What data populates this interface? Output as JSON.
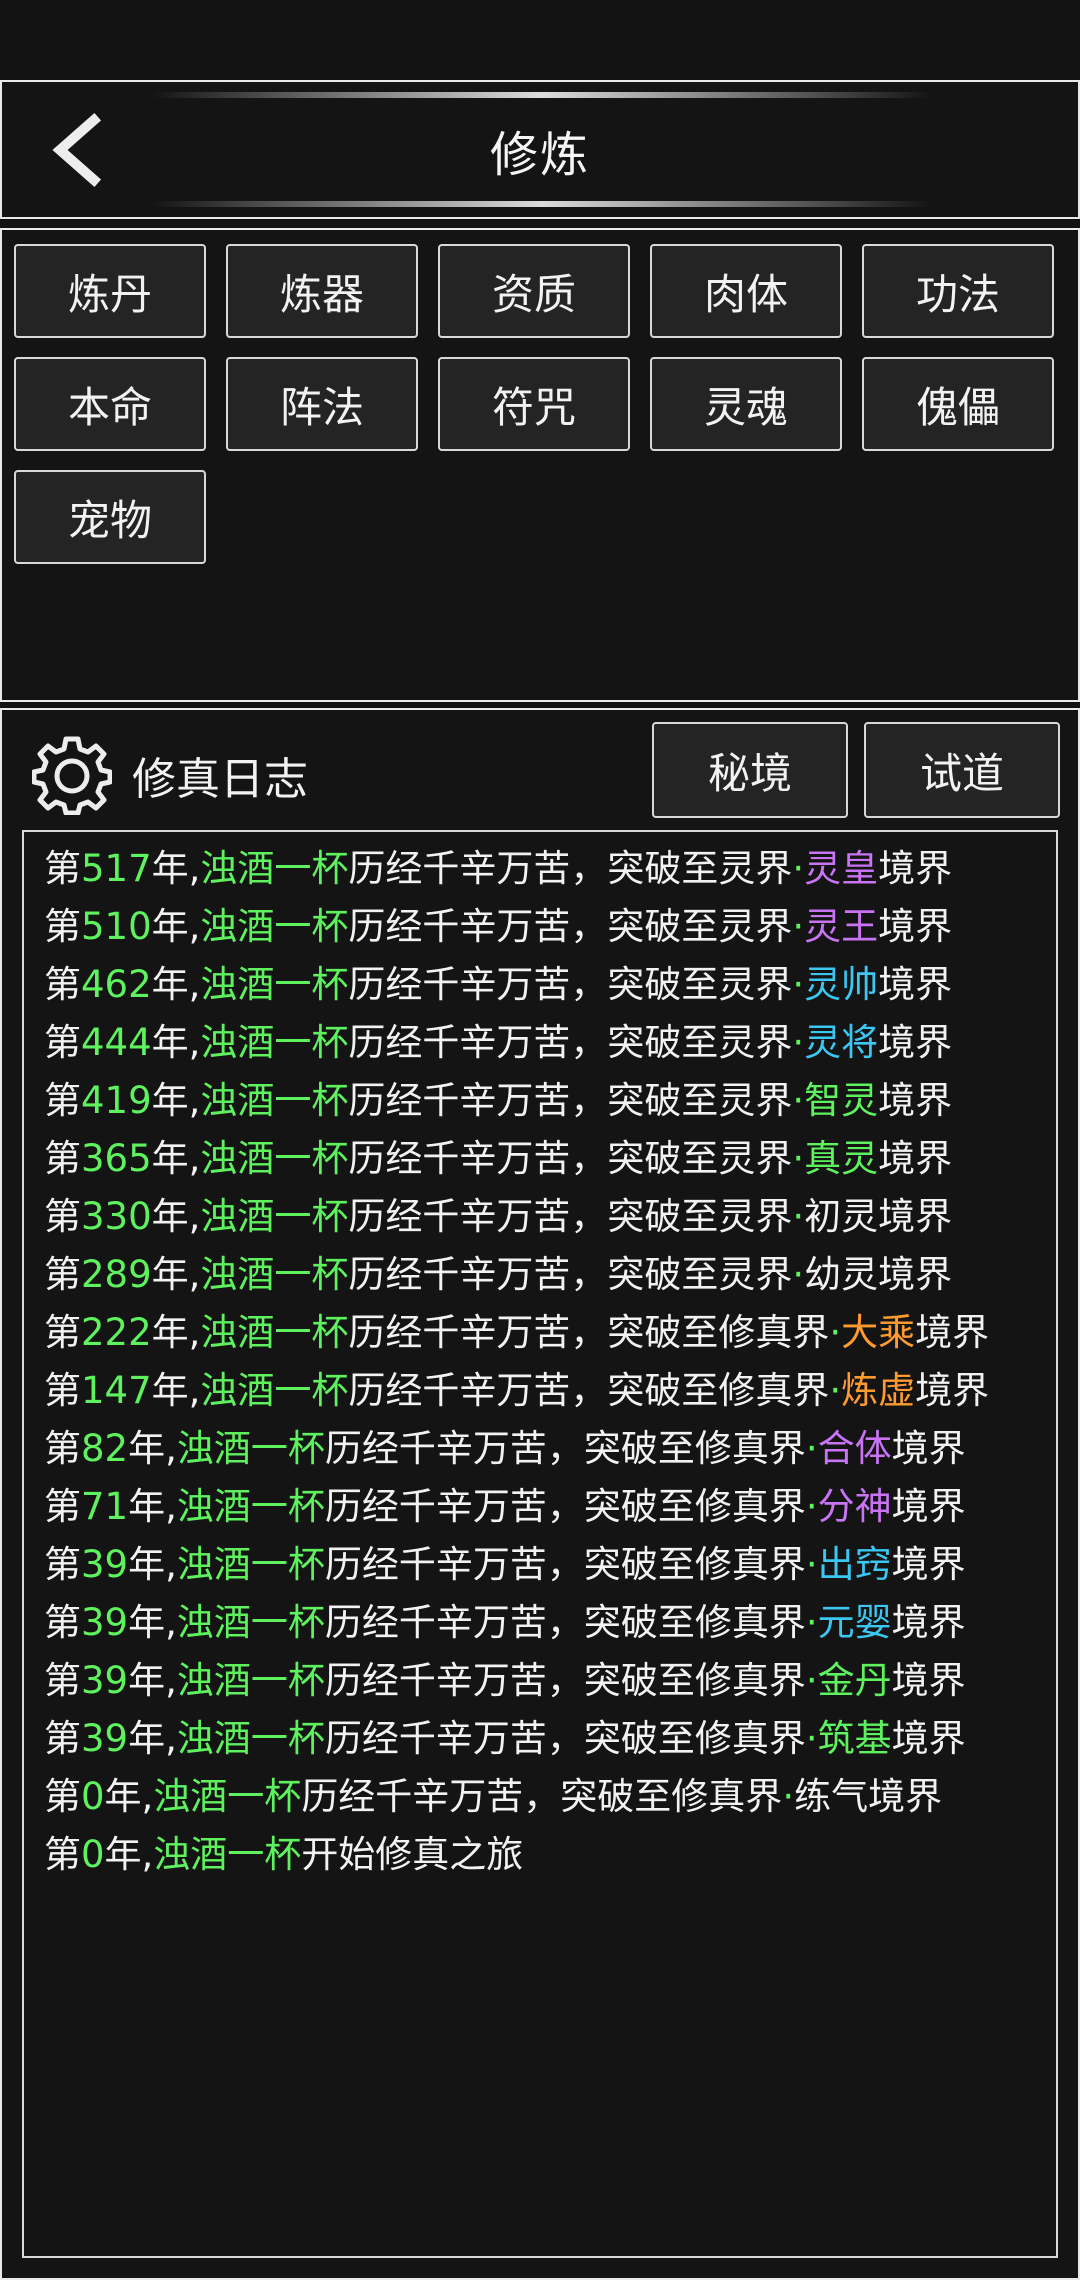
{
  "header": {
    "title": "修炼"
  },
  "categories": [
    "炼丹",
    "炼器",
    "资质",
    "肉体",
    "功法",
    "本命",
    "阵法",
    "符咒",
    "灵魂",
    "傀儡",
    "宠物"
  ],
  "log": {
    "title": "修真日志",
    "buttons": [
      "秘境",
      "试道"
    ],
    "entries": [
      {
        "prefix": "第",
        "year": "517",
        "mid": "年,",
        "name": "浊酒一杯",
        "action": "历经千辛万苦，突破至灵界",
        "dot": "·",
        "realm": "灵皇",
        "realm_color": "#c874f5",
        "suffix": "境界"
      },
      {
        "prefix": "第",
        "year": "510",
        "mid": "年,",
        "name": "浊酒一杯",
        "action": "历经千辛万苦，突破至灵界",
        "dot": "·",
        "realm": "灵王",
        "realm_color": "#c874f5",
        "suffix": "境界"
      },
      {
        "prefix": "第",
        "year": "462",
        "mid": "年,",
        "name": "浊酒一杯",
        "action": "历经千辛万苦，突破至灵界",
        "dot": "·",
        "realm": "灵帅",
        "realm_color": "#3cc6f2",
        "suffix": "境界"
      },
      {
        "prefix": "第",
        "year": "444",
        "mid": "年,",
        "name": "浊酒一杯",
        "action": "历经千辛万苦，突破至灵界",
        "dot": "·",
        "realm": "灵将",
        "realm_color": "#3cc6f2",
        "suffix": "境界"
      },
      {
        "prefix": "第",
        "year": "419",
        "mid": "年,",
        "name": "浊酒一杯",
        "action": "历经千辛万苦，突破至灵界",
        "dot": "·",
        "realm": "智灵",
        "realm_color": "#5ef25e",
        "suffix": "境界"
      },
      {
        "prefix": "第",
        "year": "365",
        "mid": "年,",
        "name": "浊酒一杯",
        "action": "历经千辛万苦，突破至灵界",
        "dot": "·",
        "realm": "真灵",
        "realm_color": "#5ef25e",
        "suffix": "境界"
      },
      {
        "prefix": "第",
        "year": "330",
        "mid": "年,",
        "name": "浊酒一杯",
        "action": "历经千辛万苦，突破至灵界",
        "dot": "·",
        "realm": "初灵",
        "realm_color": "#f2f2f2",
        "suffix": "境界"
      },
      {
        "prefix": "第",
        "year": "289",
        "mid": "年,",
        "name": "浊酒一杯",
        "action": "历经千辛万苦，突破至灵界",
        "dot": "·",
        "realm": "幼灵",
        "realm_color": "#f2f2f2",
        "suffix": "境界"
      },
      {
        "prefix": "第",
        "year": "222",
        "mid": "年,",
        "name": "浊酒一杯",
        "action": "历经千辛万苦，突破至修真界",
        "dot": "·",
        "realm": "大乘",
        "realm_color": "#ff9a2e",
        "suffix": "境界"
      },
      {
        "prefix": "第",
        "year": "147",
        "mid": "年,",
        "name": "浊酒一杯",
        "action": "历经千辛万苦，突破至修真界",
        "dot": "·",
        "realm": "炼虚",
        "realm_color": "#ff9a2e",
        "suffix": "境界"
      },
      {
        "prefix": "第",
        "year": "82",
        "mid": "年,",
        "name": "浊酒一杯",
        "action": "历经千辛万苦，突破至修真界",
        "dot": "·",
        "realm": "合体",
        "realm_color": "#c874f5",
        "suffix": "境界"
      },
      {
        "prefix": "第",
        "year": "71",
        "mid": "年,",
        "name": "浊酒一杯",
        "action": "历经千辛万苦，突破至修真界",
        "dot": "·",
        "realm": "分神",
        "realm_color": "#c874f5",
        "suffix": "境界"
      },
      {
        "prefix": "第",
        "year": "39",
        "mid": "年,",
        "name": "浊酒一杯",
        "action": "历经千辛万苦，突破至修真界",
        "dot": "·",
        "realm": "出窍",
        "realm_color": "#3cc6f2",
        "suffix": "境界"
      },
      {
        "prefix": "第",
        "year": "39",
        "mid": "年,",
        "name": "浊酒一杯",
        "action": "历经千辛万苦，突破至修真界",
        "dot": "·",
        "realm": "元婴",
        "realm_color": "#3cc6f2",
        "suffix": "境界"
      },
      {
        "prefix": "第",
        "year": "39",
        "mid": "年,",
        "name": "浊酒一杯",
        "action": "历经千辛万苦，突破至修真界",
        "dot": "·",
        "realm": "金丹",
        "realm_color": "#5ef25e",
        "suffix": "境界"
      },
      {
        "prefix": "第",
        "year": "39",
        "mid": "年,",
        "name": "浊酒一杯",
        "action": "历经千辛万苦，突破至修真界",
        "dot": "·",
        "realm": "筑基",
        "realm_color": "#5ef25e",
        "suffix": "境界"
      },
      {
        "prefix": "第",
        "year": "0",
        "mid": "年,",
        "name": "浊酒一杯",
        "action": "历经千辛万苦，突破至修真界",
        "dot": "·",
        "realm": "练气",
        "realm_color": "#f2f2f2",
        "suffix": "境界"
      },
      {
        "prefix": "第",
        "year": "0",
        "mid": "年,",
        "name": "浊酒一杯",
        "action": "开始修真之旅",
        "dot": "",
        "realm": "",
        "realm_color": "#f2f2f2",
        "suffix": ""
      }
    ]
  },
  "colors": {
    "highlight_green": "#5ef25e",
    "background": "#121212",
    "button_bg": "#242424",
    "border": "#e9e9e9"
  }
}
